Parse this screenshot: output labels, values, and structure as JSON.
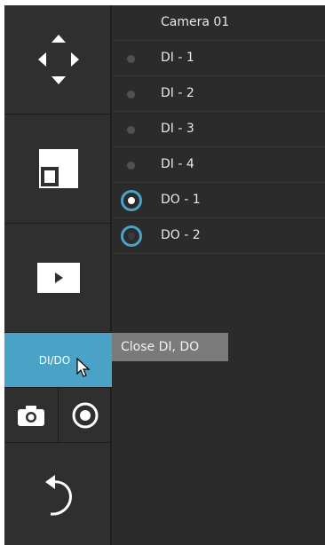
{
  "sidebar": {
    "dido_label": "DI/DO",
    "icons": {
      "nav": "directional-pad-icon",
      "layout": "layout-icon",
      "play": "play-icon",
      "snapshot": "camera-icon",
      "record": "record-icon",
      "back": "undo-arrow-icon"
    }
  },
  "panel": {
    "camera_title": "Camera 01",
    "di": [
      {
        "label": "DI - 1"
      },
      {
        "label": "DI - 2"
      },
      {
        "label": "DI - 3"
      },
      {
        "label": "DI - 4"
      }
    ],
    "do": [
      {
        "label": "DO - 1",
        "state": "on"
      },
      {
        "label": "DO - 2",
        "state": "off"
      }
    ]
  },
  "tooltip": {
    "text": "Close DI, DO"
  },
  "colors": {
    "accent": "#4aa3c6",
    "sidebar_bg": "#2f2f2f",
    "panel_bg": "#2b2b2b",
    "tooltip_bg": "#7a7a7a"
  }
}
